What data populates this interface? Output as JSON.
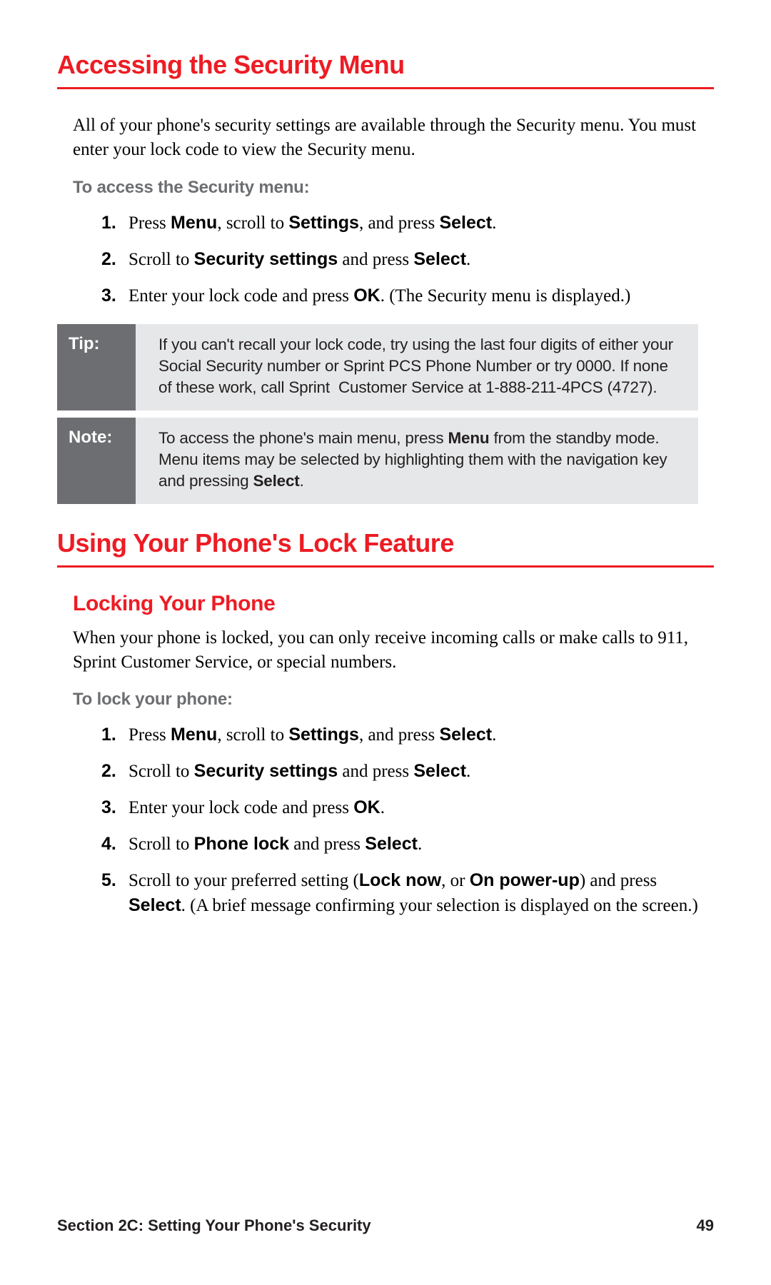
{
  "section1": {
    "title": "Accessing the Security Menu",
    "intro": "All of your phone's security settings are available through the Security menu. You must enter your lock code to view the Security menu.",
    "subhead": "To access the Security menu:",
    "steps": [
      {
        "num": "1.",
        "html": "Press <b>Menu</b>, scroll to <b>Settings</b>, and press <b>Select</b>."
      },
      {
        "num": "2.",
        "html": "Scroll to <b>Security settings</b> and press <b>Select</b>."
      },
      {
        "num": "3.",
        "html": "Enter your lock code and press <b>OK</b>. (The Security menu is displayed.)"
      }
    ],
    "tip": {
      "label": "Tip:",
      "html": "If you can't recall your lock code, try using the last four digits of either your Social Security number or Sprint PCS Phone Number or try 0000. If none of these work, call Sprint&nbsp; Customer Service at 1-888-211-4PCS (4727)."
    },
    "note": {
      "label": "Note:",
      "html": "To access the phone's main menu, press <b>Menu</b> from the standby mode. Menu items may be selected by highlighting them with the navigation key and pressing <b>Select</b>."
    }
  },
  "section2": {
    "title": "Using Your Phone's Lock Feature",
    "sub1": {
      "title": "Locking Your Phone",
      "intro": "When your phone is locked, you can only receive incoming calls or make calls to 911, Sprint Customer Service, or special numbers.",
      "subhead": "To lock your phone:",
      "steps": [
        {
          "num": "1.",
          "html": "Press <b>Menu</b>, scroll to <b>Settings</b>, and press <b>Select</b>."
        },
        {
          "num": "2.",
          "html": "Scroll to <b>Security settings</b> and press <b>Select</b>."
        },
        {
          "num": "3.",
          "html": "Enter your lock code and press <b>OK</b>."
        },
        {
          "num": "4.",
          "html": "Scroll to <b>Phone lock</b> and press <b>Select</b>."
        },
        {
          "num": "5.",
          "html": "Scroll to your preferred setting (<b>Lock now</b>, or <b>On power-up</b>) and press <b>Select</b>. (A brief message confirming your selection is displayed on the screen.)"
        }
      ]
    }
  },
  "footer": {
    "section": "Section 2C: Setting Your Phone's Security",
    "page": "49"
  }
}
